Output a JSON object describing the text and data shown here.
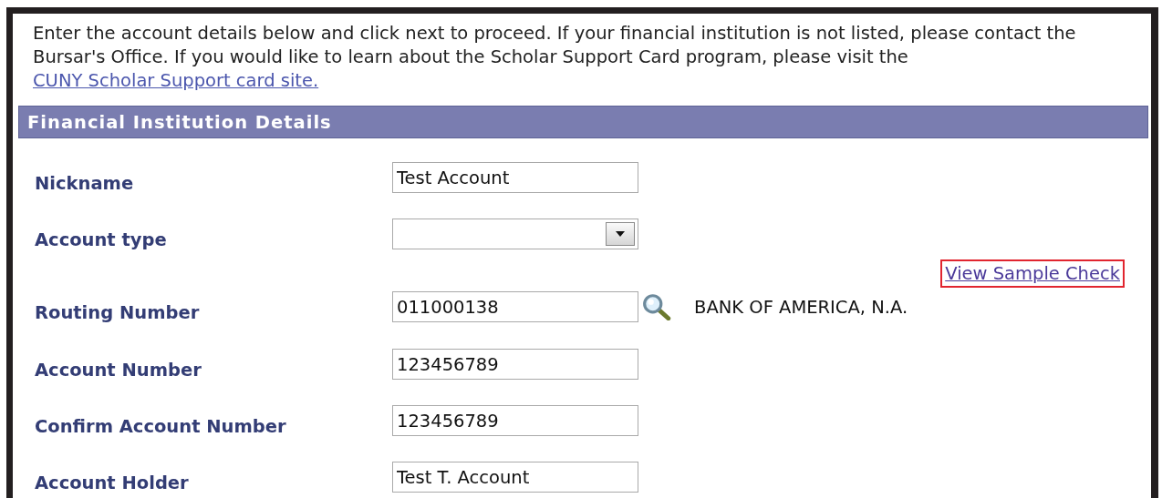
{
  "intro": {
    "text": "Enter the account details below and click next to proceed. If your financial institution is not listed, please contact the Bursar's Office. If you would like to learn about the Scholar Support Card program, please visit the ",
    "link": "CUNY Scholar Support card site."
  },
  "section": {
    "title": "Financial Institution Details"
  },
  "fields": [
    {
      "kind": "text",
      "label": "Nickname",
      "value": "Test Account"
    },
    {
      "kind": "select",
      "label": "Account type"
    },
    {
      "kind": "link",
      "text": "View Sample Check",
      "highlighted": true
    },
    {
      "kind": "lookup",
      "label": "Routing Number",
      "value": "011000138",
      "description": "BANK OF AMERICA, N.A."
    },
    {
      "kind": "text",
      "label": "Account Number",
      "value": "123456789"
    },
    {
      "kind": "text",
      "label": "Confirm Account Number",
      "value": "123456789"
    },
    {
      "kind": "text",
      "label": "Account Holder",
      "value": "Test T. Account"
    }
  ]
}
